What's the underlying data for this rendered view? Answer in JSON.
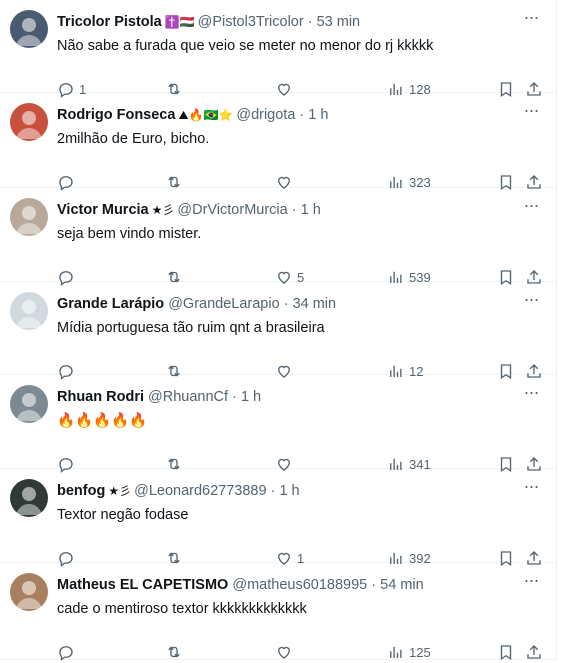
{
  "tweets": [
    {
      "name": "Tricolor Pistola",
      "badges": "✝️🇭🇺",
      "handle": "@Pistol3Tricolor",
      "time": "53 min",
      "text": "Não sabe a furada que veio se meter no menor do rj kkkkk",
      "replies": "1",
      "retweets": "",
      "likes": "",
      "views": "128",
      "avatar_color": "#4a5a70"
    },
    {
      "name": "Rodrigo Fonseca",
      "badges": "⛰🔥🇧🇷⭐",
      "handle": "@drigota",
      "time": "1 h",
      "text": "2milhão de Euro, bicho.",
      "replies": "",
      "retweets": "",
      "likes": "",
      "views": "323",
      "avatar_color": "#c8503c"
    },
    {
      "name": "Victor Murcia",
      "badges": "★彡",
      "handle": "@DrVictorMurcia",
      "time": "1 h",
      "text": "seja bem vindo mister.",
      "replies": "",
      "retweets": "",
      "likes": "5",
      "views": "539",
      "avatar_color": "#b9a99a"
    },
    {
      "name": "Grande Larápio",
      "badges": "",
      "handle": "@GrandeLarapio",
      "time": "34 min",
      "text": "Mídia portuguesa tão ruim qnt a brasileira",
      "replies": "",
      "retweets": "",
      "likes": "",
      "views": "12",
      "avatar_color": "#cfd9de"
    },
    {
      "name": "Rhuan Rodri",
      "badges": "",
      "handle": "@RhuannCf",
      "time": "1 h",
      "text": "🔥🔥🔥🔥🔥",
      "replies": "",
      "retweets": "",
      "likes": "",
      "views": "341",
      "avatar_color": "#7d8a93"
    },
    {
      "name": "benfog",
      "badges": "★彡",
      "handle": "@Leonard62773889",
      "time": "1 h",
      "text": "Textor negão fodase",
      "replies": "",
      "retweets": "",
      "likes": "1",
      "views": "392",
      "avatar_color": "#2f3a34"
    },
    {
      "name": "Matheus EL CAPETISMO",
      "badges": "",
      "handle": "@matheus60188995",
      "time": "54 min",
      "text": "cade o mentiroso textor kkkkkkkkkkkkk",
      "replies": "",
      "retweets": "",
      "likes": "",
      "views": "125",
      "avatar_color": "#a88060"
    }
  ],
  "separator": "·",
  "icons": [
    "more-icon",
    "reply-icon",
    "retweet-icon",
    "like-icon",
    "views-icon",
    "bookmark-icon",
    "share-icon"
  ]
}
